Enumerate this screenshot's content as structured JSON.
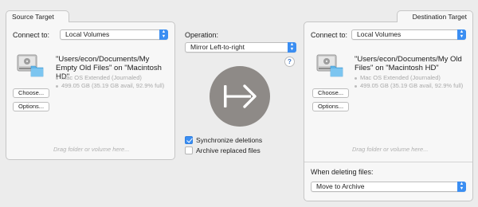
{
  "source": {
    "tab_label": "Source Target",
    "connect_label": "Connect to:",
    "connect_value": "Local Volumes",
    "path": "\"Users/econ/Documents/My Empty Old Files\" on \"Macintosh HD\"",
    "format": "Mac OS Extended (Journaled)",
    "capacity": "499.05 GB (35.19 GB avail, 92.9% full)",
    "choose_label": "Choose...",
    "options_label": "Options...",
    "drop_hint": "Drag folder or volume here..."
  },
  "operation": {
    "label": "Operation:",
    "value": "Mirror Left-to-right",
    "help_label": "?",
    "sync_label": "Synchronize deletions",
    "sync_checked": true,
    "archive_label": "Archive replaced files",
    "archive_checked": false,
    "arrow_icon": "right-arrow-icon",
    "arrow_color": "#8e8a87"
  },
  "destination": {
    "tab_label": "Destination Target",
    "connect_label": "Connect to:",
    "connect_value": "Local Volumes",
    "path": "\"Users/econ/Documents/My Old Files\" on \"Macintosh HD\"",
    "format": "Mac OS Extended (Journaled)",
    "capacity": "499.05 GB (35.19 GB avail, 92.9% full)",
    "choose_label": "Choose...",
    "options_label": "Options...",
    "drop_hint": "Drag folder or volume here...",
    "deleting_label": "When deleting files:",
    "deleting_value": "Move to Archive"
  },
  "colors": {
    "accent": "#3b8ef2"
  }
}
